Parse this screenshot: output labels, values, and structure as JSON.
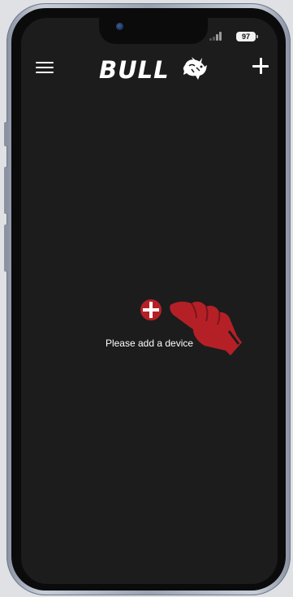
{
  "status_bar": {
    "battery": "97",
    "signal_icon": "cellular-signal-icon"
  },
  "header": {
    "menu_icon": "hamburger-menu-icon",
    "logo_text": "BULL",
    "logo_icon": "bull-mascot-icon",
    "add_icon": "plus-icon"
  },
  "main": {
    "empty_message": "Please add a device",
    "add_device_icon": "add-circle-icon",
    "hint_icon": "tap-hand-icon"
  },
  "colors": {
    "background": "#1c1c1d",
    "accent": "#b52027",
    "text": "#ffffff"
  }
}
